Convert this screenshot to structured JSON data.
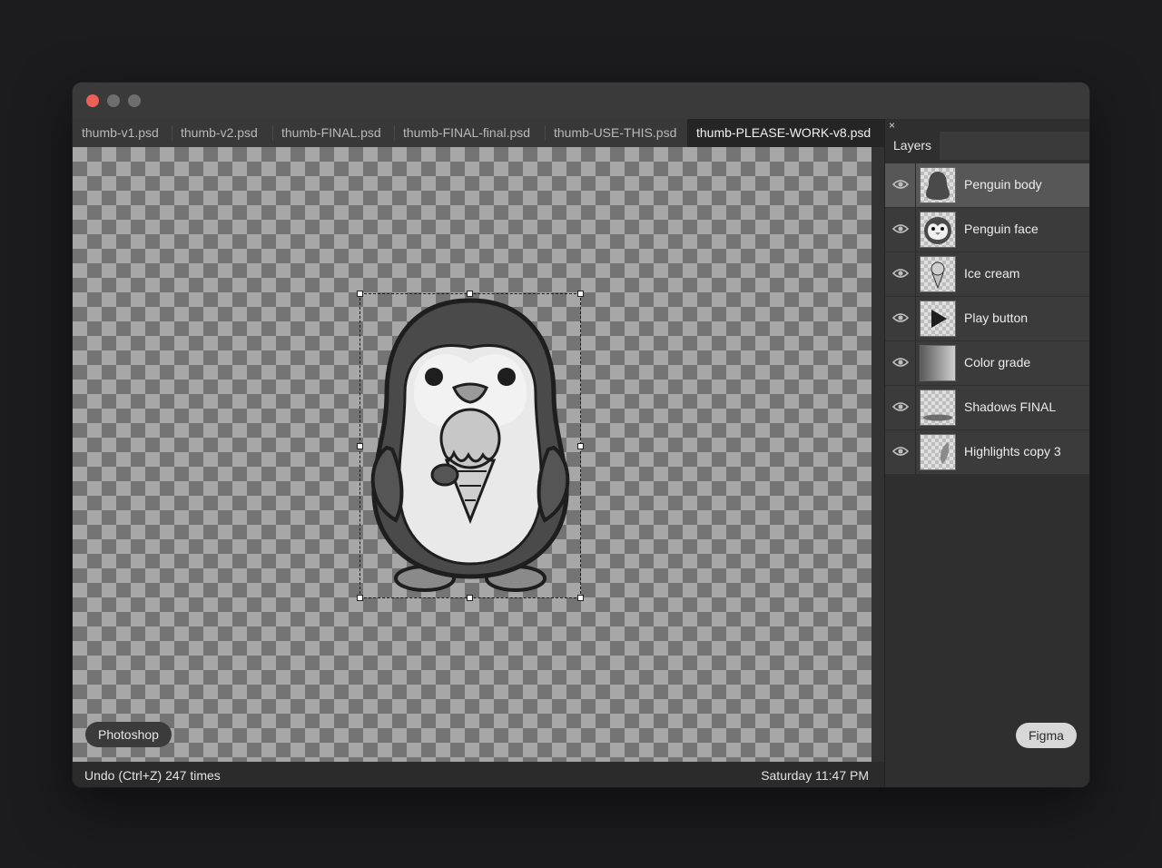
{
  "tabs": [
    {
      "label": "thumb-v1.psd"
    },
    {
      "label": "thumb-v2.psd"
    },
    {
      "label": "thumb-FINAL.psd"
    },
    {
      "label": "thumb-FINAL-final.psd"
    },
    {
      "label": "thumb-USE-THIS.psd"
    },
    {
      "label": "thumb-PLEASE-WORK-v8.psd",
      "active": true
    }
  ],
  "panel": {
    "close": "×",
    "tab": "Layers",
    "layers": [
      {
        "name": "Penguin body",
        "icon": "penguin-silhouette",
        "selected": true
      },
      {
        "name": "Penguin face",
        "icon": "penguin-face"
      },
      {
        "name": "Ice cream",
        "icon": "ice-cream"
      },
      {
        "name": "Play button",
        "icon": "play-triangle"
      },
      {
        "name": "Color grade",
        "icon": "gradient"
      },
      {
        "name": "Shadows FINAL",
        "icon": "shadow-ellipse"
      },
      {
        "name": "Highlights copy 3",
        "icon": "highlight-stroke"
      }
    ]
  },
  "canvas": {
    "left_badge": "Photoshop",
    "right_badge": "Figma"
  },
  "status": {
    "left": "Undo (Ctrl+Z) 247 times",
    "right": "Saturday 11:47 PM"
  },
  "colors": {
    "close_dot": "#ed5f57",
    "inactive_dot": "#6e6e6e",
    "selected_layer": "#575757"
  }
}
